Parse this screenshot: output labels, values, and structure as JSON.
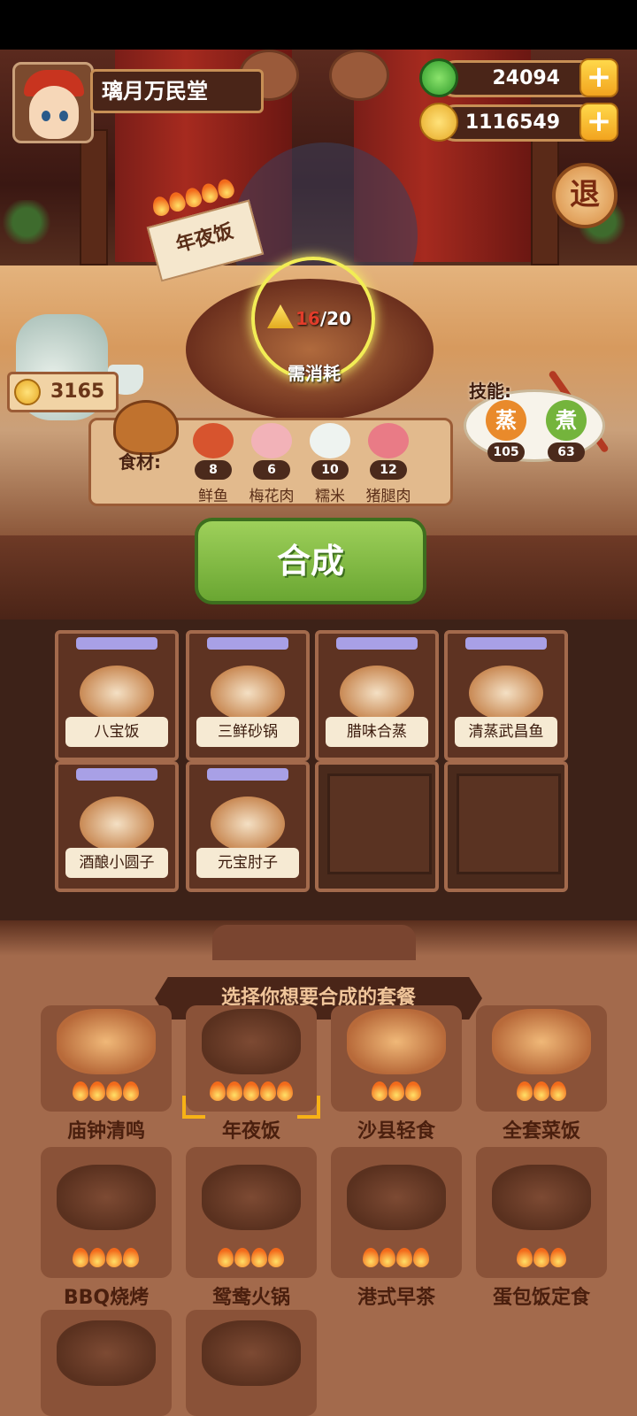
{
  "player": {
    "name": "璃月万民堂"
  },
  "resources": {
    "jade": "24094",
    "gold": "1116549",
    "add_label": "+"
  },
  "exit_label": "退",
  "jar_coins": "3165",
  "current_set": {
    "name": "年夜饭",
    "flames": 5
  },
  "requirement": {
    "current": "16",
    "total": "/20",
    "label": "需消耗"
  },
  "ingredients": {
    "label": "食材:",
    "items": [
      {
        "name": "鲜鱼",
        "count": "8",
        "color": "#d7542e"
      },
      {
        "name": "梅花肉",
        "count": "6",
        "color": "#f2b2b8"
      },
      {
        "name": "糯米",
        "count": "10",
        "color": "#eef3f0"
      },
      {
        "name": "猪腿肉",
        "count": "12",
        "color": "#e97b86"
      }
    ]
  },
  "skills": {
    "label": "技能:",
    "items": [
      {
        "name": "蒸",
        "value": "105",
        "color": "#e98a2b"
      },
      {
        "name": "煮",
        "value": "63",
        "color": "#74b43c"
      }
    ]
  },
  "synth_button": "合成",
  "dishes": [
    "八宝饭",
    "三鲜砂锅",
    "腊味合蒸",
    "清蒸武昌鱼",
    "酒酿小圆子",
    "元宝肘子"
  ],
  "chooser": {
    "title": "选择你想要合成的套餐",
    "sets": [
      {
        "name": "庙钟清鸣",
        "flames": 4,
        "bright": true
      },
      {
        "name": "年夜饭",
        "flames": 5,
        "bright": false,
        "selected": true
      },
      {
        "name": "沙县轻食",
        "flames": 3,
        "bright": true
      },
      {
        "name": "全套菜饭",
        "flames": 3,
        "bright": true
      },
      {
        "name": "BBQ烧烤",
        "flames": 4,
        "bright": false
      },
      {
        "name": "鸳鸯火锅",
        "flames": 4,
        "bright": false
      },
      {
        "name": "港式早茶",
        "flames": 4,
        "bright": false
      },
      {
        "name": "蛋包饭定食",
        "flames": 3,
        "bright": false
      }
    ]
  }
}
